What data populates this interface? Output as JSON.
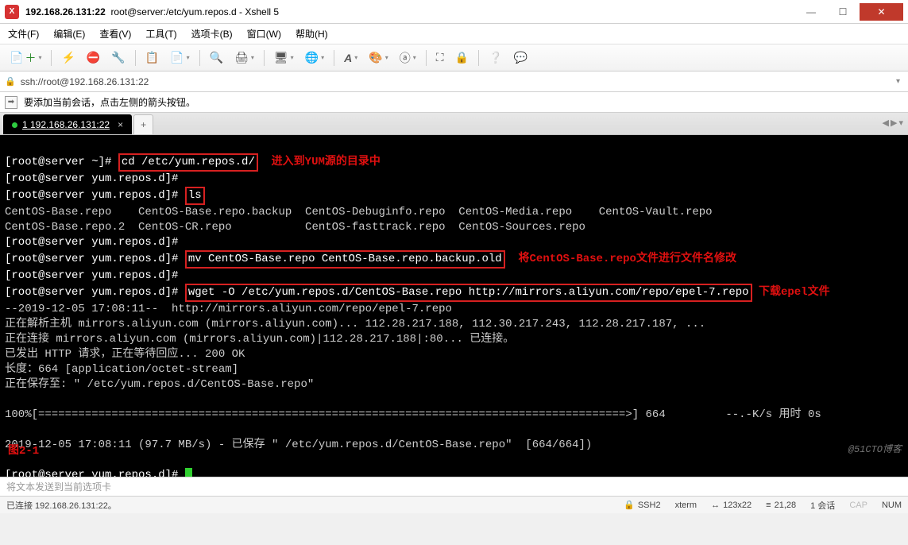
{
  "window": {
    "title": "192.168.26.131:22",
    "subtitle": "root@server:/etc/yum.repos.d - Xshell 5"
  },
  "menu": [
    "文件(F)",
    "编辑(E)",
    "查看(V)",
    "工具(T)",
    "选项卡(B)",
    "窗口(W)",
    "帮助(H)"
  ],
  "addr": {
    "url": "ssh://root@192.168.26.131:22"
  },
  "hint": "要添加当前会话，点击左侧的箭头按钮。",
  "tab": {
    "active": "1 192.168.26.131:22",
    "new": "+"
  },
  "term": {
    "l01_prompt": "[root@server ~]#",
    "l01_cmd": "cd /etc/yum.repos.d/",
    "l01_note": "进入到YUM源的目录中",
    "l02_prompt": "[root@server yum.repos.d]#",
    "l03_prompt": "[root@server yum.repos.d]#",
    "l03_cmd": "ls",
    "l04a": "CentOS-Base.repo    CentOS-Base.repo.backup  CentOS-Debuginfo.repo  CentOS-Media.repo    CentOS-Vault.repo",
    "l04b": "CentOS-Base.repo.2  CentOS-CR.repo           CentOS-fasttrack.repo  CentOS-Sources.repo",
    "l05_prompt": "[root@server yum.repos.d]#",
    "l06_prompt": "[root@server yum.repos.d]#",
    "l06_cmd": "mv CentOS-Base.repo CentOS-Base.repo.backup.old",
    "l06_note": "将CentOS-Base.repo文件进行文件名修改",
    "l07_prompt": "[root@server yum.repos.d]#",
    "l08_prompt": "[root@server yum.repos.d]#",
    "l08_cmd": "wget -O /etc/yum.repos.d/CentOS-Base.repo http://mirrors.aliyun.com/repo/epel-7.repo",
    "l08_note": "下载epel文件",
    "l09": "--2019-12-05 17:08:11--  http://mirrors.aliyun.com/repo/epel-7.repo",
    "l10": "正在解析主机 mirrors.aliyun.com (mirrors.aliyun.com)... 112.28.217.188, 112.30.217.243, 112.28.217.187, ...",
    "l11": "正在连接 mirrors.aliyun.com (mirrors.aliyun.com)|112.28.217.188|:80... 已连接。",
    "l12": "已发出 HTTP 请求，正在等待回应... 200 OK",
    "l13": "长度：664 [application/octet-stream]",
    "l14": "正在保存至: \" /etc/yum.repos.d/CentOS-Base.repo\"",
    "l15": "100%[========================================================================================>] 664         --.-K/s 用时 0s",
    "l16": "2019-12-05 17:08:11 (97.7 MB/s) - 已保存 \" /etc/yum.repos.d/CentOS-Base.repo\"  [664/664])",
    "l17_prompt": "[root@server yum.repos.d]#",
    "figcaption": "图2-1",
    "watermark": "@51CTO博客"
  },
  "inputrow": "将文本发送到当前选项卡",
  "status": {
    "conn": "已连接 192.168.26.131:22。",
    "proto": "SSH2",
    "termtype": "xterm",
    "size": "123x22",
    "pos": "21,28",
    "sess": "1 会话",
    "caps": "CAP",
    "num": "NUM",
    "scroll": ""
  }
}
